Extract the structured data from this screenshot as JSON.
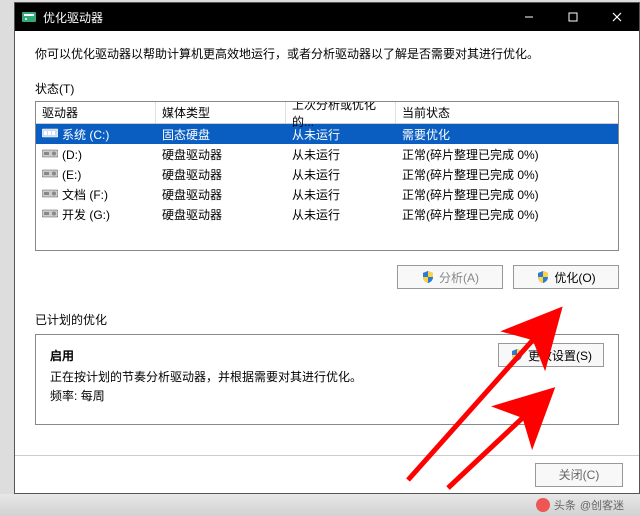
{
  "window": {
    "title": "优化驱动器"
  },
  "description": "你可以优化驱动器以帮助计算机更高效地运行，或者分析驱动器以了解是否需要对其进行优化。",
  "status_label": "状态(T)",
  "columns": {
    "drive": "驱动器",
    "media": "媒体类型",
    "last": "上次分析或优化的...",
    "current": "当前状态"
  },
  "rows": [
    {
      "icon": "ssd",
      "name": "系统 (C:)",
      "media": "固态硬盘",
      "last": "从未运行",
      "current": "需要优化",
      "selected": true
    },
    {
      "icon": "hdd",
      "name": "(D:)",
      "media": "硬盘驱动器",
      "last": "从未运行",
      "current": "正常(碎片整理已完成 0%)",
      "selected": false
    },
    {
      "icon": "hdd",
      "name": "(E:)",
      "media": "硬盘驱动器",
      "last": "从未运行",
      "current": "正常(碎片整理已完成 0%)",
      "selected": false
    },
    {
      "icon": "hdd",
      "name": "文档 (F:)",
      "media": "硬盘驱动器",
      "last": "从未运行",
      "current": "正常(碎片整理已完成 0%)",
      "selected": false
    },
    {
      "icon": "hdd",
      "name": "开发 (G:)",
      "media": "硬盘驱动器",
      "last": "从未运行",
      "current": "正常(碎片整理已完成 0%)",
      "selected": false
    }
  ],
  "buttons": {
    "analyze": "分析(A)",
    "optimize": "优化(O)",
    "change": "更改设置(S)",
    "close": "关闭(C)"
  },
  "schedule": {
    "section_label": "已计划的优化",
    "heading": "启用",
    "line1": "正在按计划的节奏分析驱动器，并根据需要对其进行优化。",
    "freq_label": "频率:",
    "freq_value": "每周"
  },
  "watermark": {
    "prefix": "头条",
    "author": "@创客迷"
  }
}
